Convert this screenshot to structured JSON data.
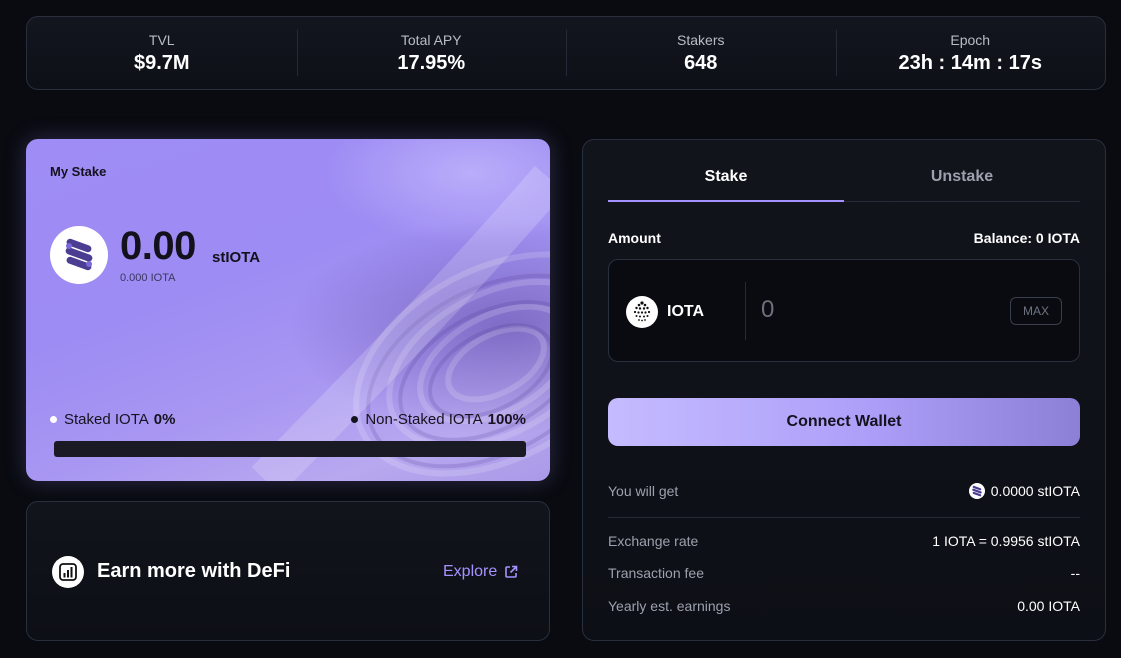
{
  "stats": [
    {
      "label": "TVL",
      "value": "$9.7M"
    },
    {
      "label": "Total APY",
      "value": "17.95%"
    },
    {
      "label": "Stakers",
      "value": "648"
    },
    {
      "label": "Epoch",
      "value": "23h : 14m : 17s"
    }
  ],
  "my_stake": {
    "title": "My Stake",
    "amount": "0.00",
    "unit": "stIOTA",
    "sub_amount": "0.000 IOTA",
    "staked_label": "Staked IOTA",
    "staked_percent": "0%",
    "non_staked_label": "Non-Staked IOTA",
    "non_staked_percent": "100%",
    "staked_fraction": 0
  },
  "defi": {
    "title": "Earn more with DeFi",
    "link_label": "Explore"
  },
  "panel": {
    "tabs": [
      "Stake",
      "Unstake"
    ],
    "amount_label": "Amount",
    "balance": "Balance: 0 IOTA",
    "token": "IOTA",
    "input_placeholder": "0",
    "max_label": "MAX",
    "connect_label": "Connect Wallet",
    "you_will_get_label": "You will get",
    "you_will_get_value": "0.0000 stIOTA",
    "details": [
      {
        "label": "Exchange rate",
        "value": "1 IOTA = 0.9956 stIOTA"
      },
      {
        "label": "Transaction fee",
        "value": "--"
      },
      {
        "label": "Yearly est. earnings",
        "value": "0.00 IOTA"
      }
    ]
  },
  "colors": {
    "accent": "#a493ff",
    "background": "#090b11",
    "card_purple": "#9f8df5"
  }
}
